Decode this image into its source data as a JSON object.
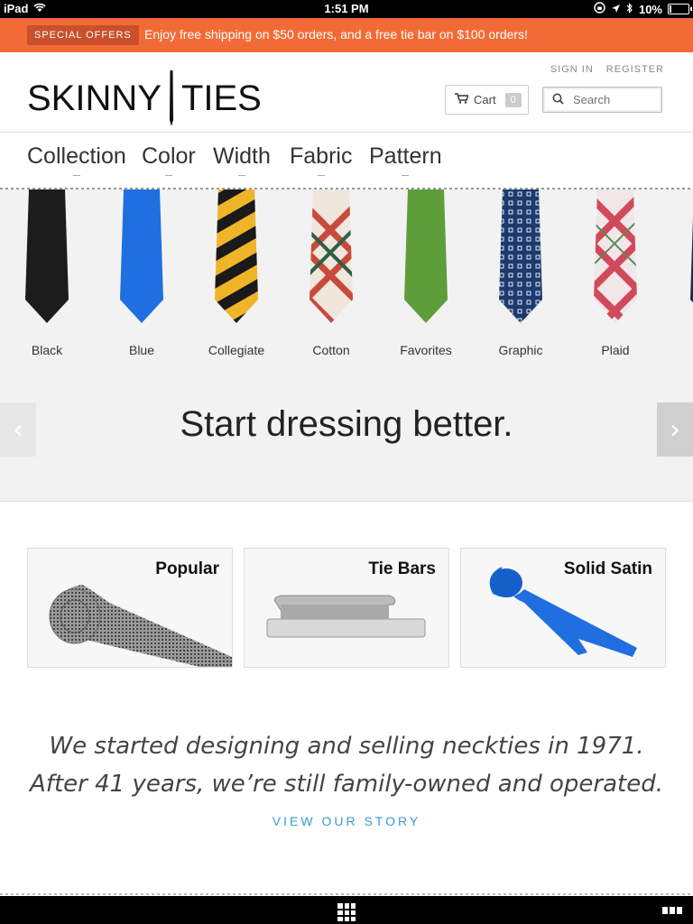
{
  "status": {
    "device": "iPad",
    "time": "1:51 PM",
    "battery": "10%",
    "battery_level": 0.1
  },
  "promo": {
    "badge": "SPECIAL OFFERS",
    "message": "Enjoy free shipping on $50 orders, and a free tie bar on $100 orders!"
  },
  "header": {
    "logo_left": "SKINNY",
    "logo_right": "TIES",
    "sign_in": "SIGN IN",
    "register": "REGISTER",
    "cart_label": "Cart",
    "cart_count": "0",
    "search_placeholder": "Search"
  },
  "nav": {
    "tabs": [
      "Collection",
      "Color",
      "Width",
      "Fabric",
      "Pattern"
    ]
  },
  "carousel": {
    "ties": [
      {
        "label": "Black",
        "color": "#1c1c1c"
      },
      {
        "label": "Blue",
        "color": "#1f6fe0"
      },
      {
        "label": "Collegiate",
        "color": "#f0b429"
      },
      {
        "label": "Cotton",
        "color": "#c84a3a"
      },
      {
        "label": "Favorites",
        "color": "#5e9e3a"
      },
      {
        "label": "Graphic",
        "color": "#1d3a6e"
      },
      {
        "label": "Plaid",
        "color": "#d04a5c"
      }
    ],
    "headline": "Start dressing better."
  },
  "cards": [
    {
      "title": "Popular"
    },
    {
      "title": "Tie Bars"
    },
    {
      "title": "Solid Satin"
    }
  ],
  "story": {
    "line1": "We started designing and selling neckties in 1971.",
    "line2": "After 41 years, we’re still family-owned and operated.",
    "link": "VIEW OUR STORY"
  },
  "colors": {
    "promo_bg": "#f26b36",
    "link": "#3a9ad9"
  }
}
